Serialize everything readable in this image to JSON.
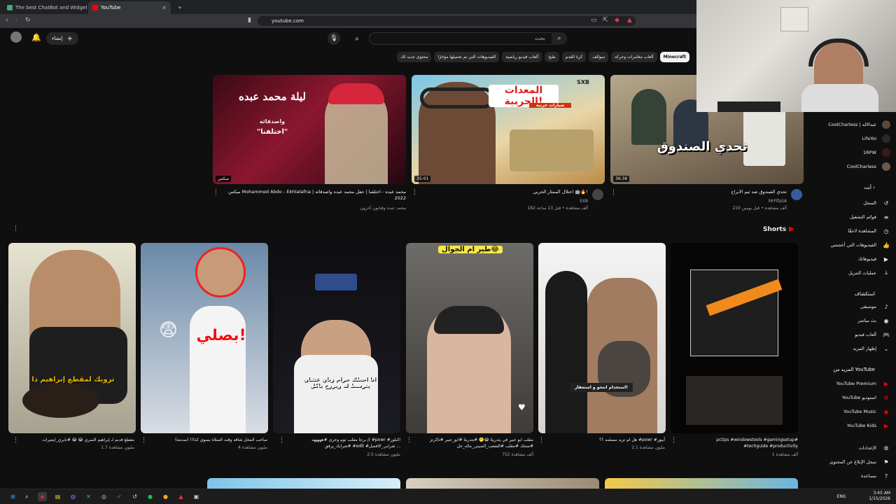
{
  "browser": {
    "tabs": [
      {
        "title": "The best ChatBot and Widgets for K",
        "active": false
      },
      {
        "title": "YouTube",
        "active": true
      }
    ],
    "url": "youtube.com"
  },
  "header": {
    "create_label": "إنشاء",
    "search_placeholder": "بحث"
  },
  "chips": [
    "Minecraft",
    "ألعاب مغامرات وحركة",
    "سوالف",
    "كرة القدم",
    "طبخ",
    "ألعاب فيديو رياضية",
    "الفيديوهات التي تم تحميلها مؤخرًا",
    "محتوى جديد لك"
  ],
  "videos": [
    {
      "title": "ميكس Mohammed Abdo - Ekhtalafna | محمد عبده - اختلفنا | حفل محمد عبده واصدقائه 2022",
      "channel": "محمد عبده وفنانون آخرون",
      "meta": "",
      "badge": "ميكس",
      "duration": "",
      "thumb_text_1": "ليلة محمد عبده",
      "thumb_text_2": "واصدقائه",
      "thumb_text_3": "\"اختلفنا\""
    },
    {
      "title": "اختلال الممثار الحربي 🤖🔥!",
      "channel": "SXB",
      "meta": "182 ألف مشاهدة • قبل 13 ساعة",
      "duration": "35:01",
      "thumb_text_1": "المعدات الحربية!",
      "thumb_text_2": "SXB",
      "thumb_text_3": "ضيارات حربية"
    },
    {
      "title": "تحدي الصندوق ضد ثيم الابراج",
      "channel": "MrFifaSA",
      "meta": "210 ألف مشاهدة • قبل يومين",
      "duration": "36:36",
      "thumb_text_1": "تحدي الصندوق",
      "thumb_text_2": "",
      "thumb_text_3": ""
    }
  ],
  "shorts": {
    "heading": "Shorts",
    "items": [
      {
        "title": "pctips #windowstools #gamingsetup# #techguide #productivity",
        "views": "1 ألف مشاهدة",
        "overlay": ""
      },
      {
        "title": "هل ام تزيد مسلمه ؟؟ #powr #أبيور",
        "views": "2.1 مليون مشاهدة",
        "overlay": "استخدام انتحو و استغفار!"
      },
      {
        "title": "مقلب ابو عبير في يتدريثا 😂🫢 #يتدريثا #ابو_عبير #تاكرتز #ضحك #مقلب #الشعب_الصيني_ماله_حل",
        "views": "752 ألف مشاهدة",
        "overlay": "طير ام الجوال😂"
      },
      {
        "title": "برجا مقلب ثوم وجرى #هههههه // #powr #اكبلور #شرابك_يرفق #edit #شرابي_الافضل ...",
        "views": "2.5 مليون مشاهدة",
        "overlay": "انا احطك حرام زيان عشان يتوسط له ويروح ياكل"
      },
      {
        "title": "صاحب المحل شافه وقت الصلاة يسوي كذا!! (صدمة)",
        "views": "4 مليون مشاهدة",
        "overlay": "بصلي!"
      },
      {
        "title": "مقطع قديم لـ إبراهيم السري 😂 😂 #بابري_اينتيرات",
        "views": "1.7 مليون مشاهدة",
        "overlay": "ترويك لمقطع إبراهيم ذا"
      }
    ]
  },
  "sidebar": {
    "subscriptions": [
      {
        "label": "CoolCharless | عبدالاله"
      },
      {
        "label": "LifeYoi"
      },
      {
        "label": "1RPW"
      },
      {
        "label": "CoolCharless"
      }
    ],
    "you_heading": "أنت",
    "you_items": [
      {
        "label": "السجل",
        "icon": "history-icon",
        "glyph": "↺"
      },
      {
        "label": "قوائم التشغيل",
        "icon": "playlist-icon",
        "glyph": "≡"
      },
      {
        "label": "المشاهدة لاحقًا",
        "icon": "clock-icon",
        "glyph": "◷"
      },
      {
        "label": "الفيديوهات التي أعجبتني",
        "icon": "thumb-up-icon",
        "glyph": "👍"
      },
      {
        "label": "فيديوهاتك",
        "icon": "video-icon",
        "glyph": "▶"
      },
      {
        "label": "عمليات التنزيل",
        "icon": "download-icon",
        "glyph": "⤓"
      }
    ],
    "explore_heading": "استكشاف",
    "explore_items": [
      {
        "label": "موسيقى",
        "icon": "music-icon",
        "glyph": "♪"
      },
      {
        "label": "بث مباشر",
        "icon": "live-icon",
        "glyph": "◉"
      },
      {
        "label": "ألعاب فيديو",
        "icon": "gamepad-icon",
        "glyph": "🎮"
      },
      {
        "label": "إظهار المزيد",
        "icon": "chevron-down-icon",
        "glyph": "⌄"
      }
    ],
    "more_heading": "المزيد من YouTube",
    "more_items": [
      {
        "label": "YouTube Premium"
      },
      {
        "label": "YouTube استوديو"
      },
      {
        "label": "YouTube Music"
      },
      {
        "label": "YouTube Kids"
      }
    ],
    "settings_items": [
      {
        "label": "الإعدادات",
        "icon": "gear-icon",
        "glyph": "⚙"
      },
      {
        "label": "سجل الإبلاغ عن المحتوى",
        "icon": "flag-icon",
        "glyph": "⚑"
      },
      {
        "label": "مساعدة",
        "icon": "help-icon",
        "glyph": "?"
      }
    ]
  },
  "taskbar": {
    "lang": "ENG",
    "time": "3:45 AM",
    "date": "1/15/2026"
  },
  "colors": {
    "accent": "#ff0000",
    "bg": "#0f0f0f",
    "chip_bg": "#272727"
  }
}
